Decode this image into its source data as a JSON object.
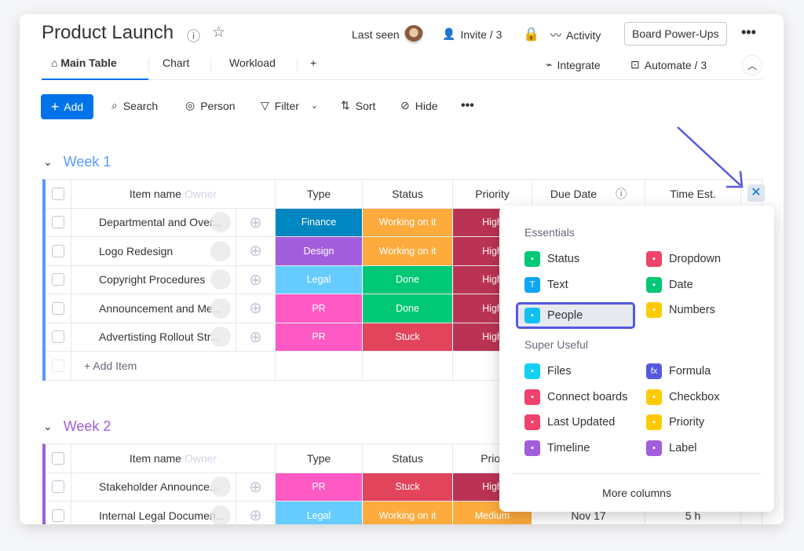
{
  "board": {
    "title": "Product Launch"
  },
  "header": {
    "last_seen": "Last seen",
    "invite": "Invite / 3",
    "activity": "Activity",
    "power_ups": "Board Power-Ups",
    "integrate": "Integrate",
    "automate": "Automate / 3"
  },
  "tabs": [
    {
      "label": "Main Table"
    },
    {
      "label": "Chart"
    },
    {
      "label": "Workload"
    },
    {
      "label": "+"
    }
  ],
  "toolbar": {
    "add": "Add",
    "search": "Search",
    "person": "Person",
    "filter": "Filter",
    "sort": "Sort",
    "hide": "Hide"
  },
  "columns": {
    "item": "Item name",
    "owner": "Owner",
    "type": "Type",
    "status": "Status",
    "priority": "Priority",
    "priority_cut": "Prior",
    "due": "Due Date",
    "time": "Time Est."
  },
  "colors": {
    "Finance": "#0086c0",
    "Design": "#a25ddc",
    "Legal": "#66ccff",
    "PR": "#ff5ac4",
    "Working on it": "#fdab3d",
    "Done": "#00c875",
    "Stuck": "#e2445c",
    "High": "#bb3354",
    "Medium": "#fdab3d",
    "week1": "#579bfc",
    "week2": "#a25ddc",
    "accent": "#0073ea",
    "highlight": "#5559df"
  },
  "groups": [
    {
      "title": "Week 1",
      "add_item": "+ Add Item",
      "rows": [
        {
          "name": "Departmental and Over...",
          "type": "Finance",
          "status": "Working on it",
          "priority": "High"
        },
        {
          "name": "Logo Redesign",
          "type": "Design",
          "status": "Working on it",
          "priority": "High"
        },
        {
          "name": "Copyright Procedures",
          "type": "Legal",
          "status": "Done",
          "priority": "High"
        },
        {
          "name": "Announcement and Me...",
          "type": "PR",
          "status": "Done",
          "priority": "High"
        },
        {
          "name": "Advertisting Rollout Str...",
          "type": "PR",
          "status": "Stuck",
          "priority": "High"
        }
      ]
    },
    {
      "title": "Week 2",
      "rows": [
        {
          "name": "Stakeholder Announce...",
          "type": "PR",
          "status": "Stuck",
          "priority": "High"
        },
        {
          "name": "Internal Legal Documen...",
          "type": "Legal",
          "status": "Working on it",
          "priority": "Medium",
          "due": "Nov 17",
          "time": "5 h"
        }
      ]
    }
  ],
  "column_picker": {
    "essentials_label": "Essentials",
    "super_label": "Super Useful",
    "more": "More columns",
    "selected": "People",
    "essentials": [
      {
        "label": "Status",
        "color": "#00c875",
        "icon": "status-icon"
      },
      {
        "label": "Dropdown",
        "color": "#f0426b",
        "icon": "dropdown-icon"
      },
      {
        "label": "Text",
        "color": "#0da5f5",
        "icon": "text-icon"
      },
      {
        "label": "Date",
        "color": "#00c875",
        "icon": "date-icon"
      },
      {
        "label": "People",
        "color": "#11c0f2",
        "icon": "people-icon"
      },
      {
        "label": "Numbers",
        "color": "#ffcb00",
        "icon": "numbers-icon"
      }
    ],
    "super": [
      {
        "label": "Files",
        "color": "#11d2f5",
        "icon": "files-icon"
      },
      {
        "label": "Formula",
        "color": "#5559df",
        "icon": "formula-icon"
      },
      {
        "label": "Connect boards",
        "color": "#f0426b",
        "icon": "connect-boards-icon"
      },
      {
        "label": "Checkbox",
        "color": "#ffcb00",
        "icon": "checkbox-icon"
      },
      {
        "label": "Last Updated",
        "color": "#f0426b",
        "icon": "last-updated-icon"
      },
      {
        "label": "Priority",
        "color": "#ffcb00",
        "icon": "priority-icon"
      },
      {
        "label": "Timeline",
        "color": "#a25ddc",
        "icon": "timeline-icon"
      },
      {
        "label": "Label",
        "color": "#a25ddc",
        "icon": "label-icon"
      }
    ]
  }
}
